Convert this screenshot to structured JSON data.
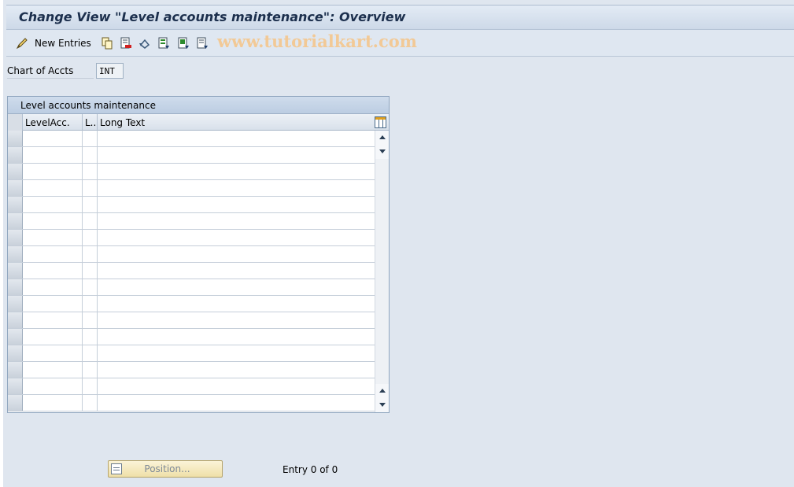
{
  "window": {
    "title": "Change View \"Level accounts maintenance\": Overview"
  },
  "toolbar": {
    "new_entries_label": "New Entries",
    "watermark": "www.tutorialkart.com",
    "icons": [
      "edit-pencil-icon",
      "copy-icon",
      "delete-icon",
      "undo-icon",
      "select-all-icon",
      "select-block-icon",
      "deselect-all-icon"
    ]
  },
  "header_field": {
    "label": "Chart of Accts",
    "value": "INT"
  },
  "table": {
    "title": "Level accounts maintenance",
    "columns": [
      "LevelAcc.",
      "L..",
      "Long Text"
    ],
    "visible_row_count": 17,
    "rows": []
  },
  "footer": {
    "position_label": "Position...",
    "entry_status": "Entry 0 of 0"
  },
  "colors": {
    "background": "#dfe6ef",
    "title_text": "#1c2f4d",
    "watermark": "#f2c996"
  }
}
